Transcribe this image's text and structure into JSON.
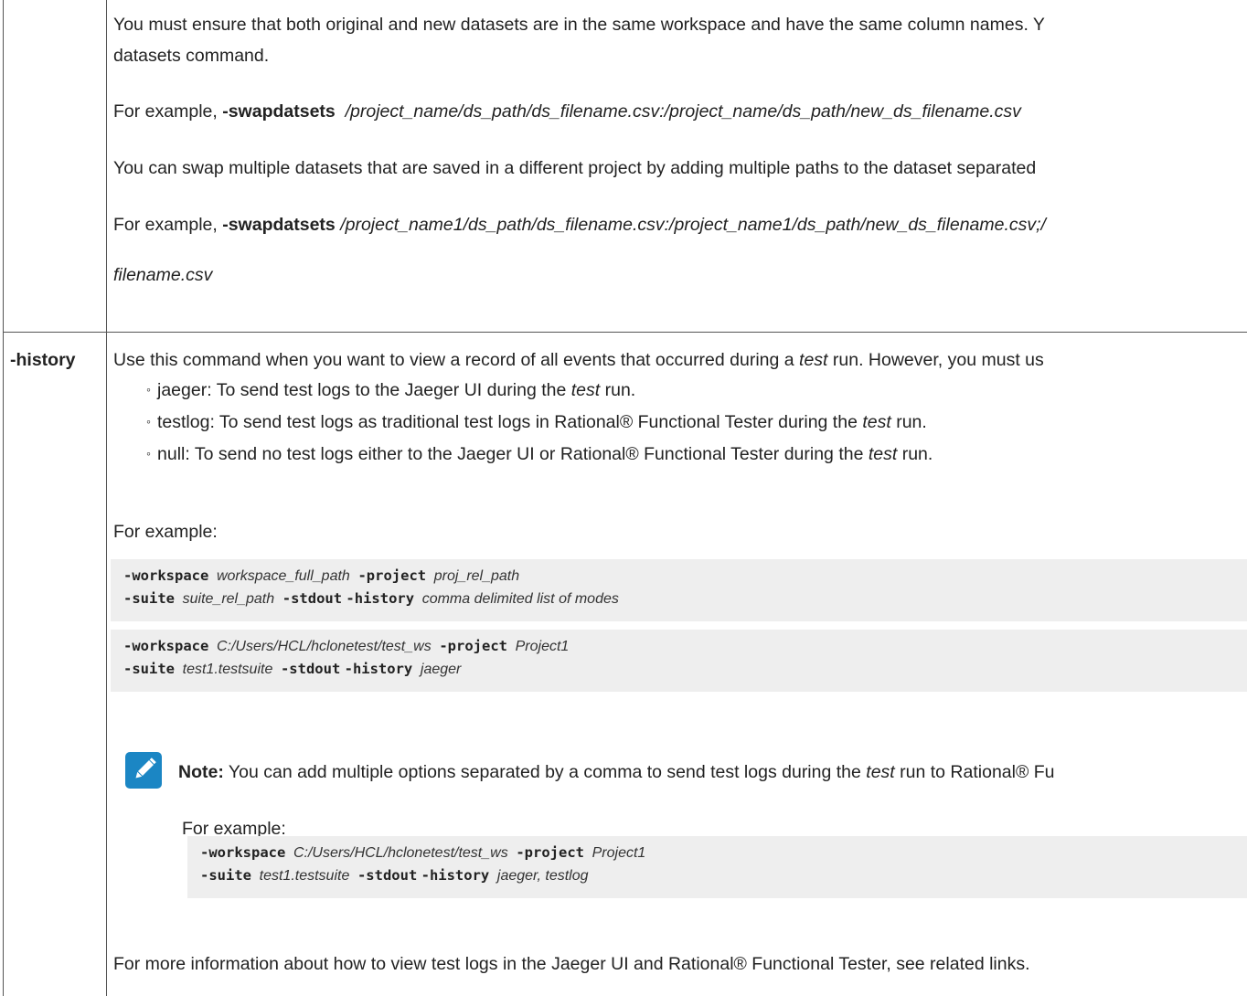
{
  "swap": {
    "para1_line1": "You must ensure that both original and new datasets are in the same workspace and have the same column names. Y",
    "para1_line2": "datasets command.",
    "example1_prefix": "For example, ",
    "example1_cmd": "-swapdatsets",
    "example1_path": "/project_name/ds_path/ds_filename.csv:/project_name/ds_path/new_ds_filename.csv",
    "para2": "You can swap multiple datasets that are saved in a different project by adding multiple paths to the dataset separated",
    "example2_prefix": "For example, ",
    "example2_cmd": "-swapdatsets",
    "example2_path": "/project_name1/ds_path/ds_filename.csv:/project_name1/ds_path/new_ds_filename.csv;/",
    "example2_line2": "filename.csv"
  },
  "history": {
    "label": "-history",
    "intro_a": "Use this command when you want to view a record of all events that occurred during a ",
    "intro_test": "test",
    "intro_b": " run. However, you must us",
    "modes": [
      {
        "a": "jaeger: To send test logs to the Jaeger UI during the ",
        "test": "test",
        "b": " run."
      },
      {
        "a": "testlog: To send test logs as traditional test logs in Rational® Functional Tester during the ",
        "test": "test",
        "b": " run."
      },
      {
        "a": "null: To send no test logs either to the Jaeger UI or Rational® Functional Tester during the ",
        "test": "test",
        "b": " run."
      }
    ],
    "for_example": "For example:",
    "code1": {
      "workspace_kw": "-workspace",
      "workspace_val": "workspace_full_path",
      "project_kw": "-project",
      "project_val": "proj_rel_path",
      "suite_kw": "-suite",
      "suite_val": "suite_rel_path",
      "stdout_kw": "-stdout",
      "history_kw": "-history",
      "history_val": "comma delimited list of modes"
    },
    "code2": {
      "workspace_kw": "-workspace",
      "workspace_val": "C:/Users/HCL/hclonetest/test_ws",
      "project_kw": "-project",
      "project_val": "Project1",
      "suite_kw": "-suite",
      "suite_val": "test1.testsuite",
      "stdout_kw": "-stdout",
      "history_kw": "-history",
      "history_val": "jaeger"
    },
    "note": {
      "label": "Note:",
      "text_a": " You can add multiple options separated by a comma to send test logs during the ",
      "test": "test",
      "text_b": " run to Rational® Fu",
      "for_example": "For example:",
      "code": {
        "workspace_kw": "-workspace",
        "workspace_val": "C:/Users/HCL/hclonetest/test_ws",
        "project_kw": "-project",
        "project_val": "Project1",
        "suite_kw": "-suite",
        "suite_val": "test1.testsuite",
        "stdout_kw": "-stdout",
        "history_kw": "-history",
        "history_val": "jaeger, testlog"
      }
    },
    "more_info": "For more information about how to view test logs in the Jaeger UI and Rational® Functional Tester, see related links."
  },
  "icons": {
    "note_icon": "pencil-icon",
    "note_icon_color": "#1b86c4"
  }
}
